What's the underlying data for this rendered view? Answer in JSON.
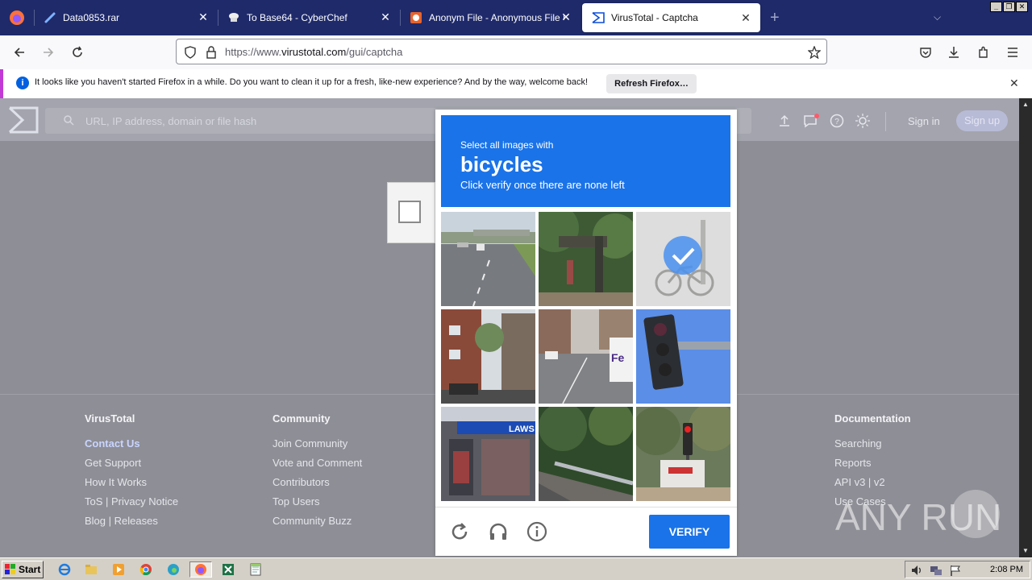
{
  "browser": {
    "tabs": [
      {
        "label": "Data0853.rar",
        "icon": "link-icon"
      },
      {
        "label": "To Base64 - CyberChef",
        "icon": "chef-hat-icon"
      },
      {
        "label": "Anonym File - Anonymous File Uplo",
        "icon": "upload-site-icon"
      },
      {
        "label": "VirusTotal - Captcha",
        "icon": "virustotal-icon"
      }
    ],
    "url_prefix": "https://www.",
    "url_domain": "virustotal.com",
    "url_path": "/gui/captcha"
  },
  "notification": {
    "text": "It looks like you haven't started Firefox in a while. Do you want to clean it up for a fresh, like-new experience? And by the way, welcome back!",
    "button": "Refresh Firefox…"
  },
  "vt": {
    "search_placeholder": "URL, IP address, domain or file hash",
    "sign_in": "Sign in",
    "sign_up": "Sign up"
  },
  "footer": {
    "col1": {
      "title": "VirusTotal",
      "links": [
        "Contact Us",
        "Get Support",
        "How It Works",
        "ToS | Privacy Notice",
        "Blog | Releases"
      ]
    },
    "col2": {
      "title": "Community",
      "links": [
        "Join Community",
        "Vote and Comment",
        "Contributors",
        "Top Users",
        "Community Buzz"
      ]
    },
    "col3": {
      "title": "Documentation",
      "links": [
        "Searching",
        "Reports",
        "API v3 | v2",
        "Use Cases"
      ]
    }
  },
  "captcha": {
    "instruction": "Select all images with",
    "target": "bicycles",
    "subtitle": "Click verify once there are none left",
    "verify": "VERIFY",
    "tiles": [
      {
        "desc": "highway road",
        "selected": false
      },
      {
        "desc": "overpass trees",
        "selected": false
      },
      {
        "desc": "bicycle",
        "selected": true
      },
      {
        "desc": "brick building street",
        "selected": false
      },
      {
        "desc": "street with van",
        "selected": false
      },
      {
        "desc": "traffic light",
        "selected": false
      },
      {
        "desc": "store front",
        "selected": false
      },
      {
        "desc": "road guardrail",
        "selected": false
      },
      {
        "desc": "traffic light sign",
        "selected": false
      }
    ]
  },
  "watermark": "ANY RUN",
  "taskbar": {
    "start": "Start",
    "clock": "2:08 PM"
  }
}
